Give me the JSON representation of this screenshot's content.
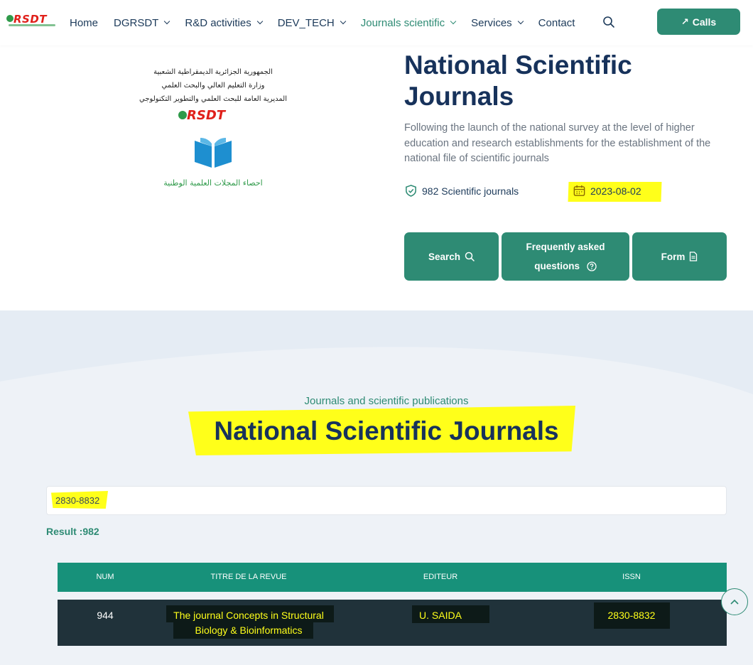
{
  "brand": {
    "logo_text": "RSDT"
  },
  "nav": {
    "items": [
      {
        "label": "Home",
        "has_dropdown": false,
        "active": false
      },
      {
        "label": "DGRSDT",
        "has_dropdown": true,
        "active": false
      },
      {
        "label": "R&D activities",
        "has_dropdown": true,
        "active": false
      },
      {
        "label": "DEV_TECH",
        "has_dropdown": true,
        "active": false
      },
      {
        "label": "Journals scientific",
        "has_dropdown": true,
        "active": true
      },
      {
        "label": "Services",
        "has_dropdown": true,
        "active": false
      },
      {
        "label": "Contact",
        "has_dropdown": false,
        "active": false
      }
    ],
    "search_icon": "search-icon",
    "calls_label": "Calls"
  },
  "hero": {
    "arabic_lines": [
      "الجمهورية الجزائرية الديمقراطية الشعبية",
      "وزارة التعليم العالي والبحث العلمي",
      "المديرية العامة للبحث العلمي والتطوير التكنولوجي"
    ],
    "arabic_caption": "احصاء المجلات العلمية الوطنية",
    "title": "National Scientific Journals",
    "description": "Following the launch of the national survey at the level of higher education and research establishments for the establishment of the national file of scientific journals",
    "journals_count": "982 Scientific journals",
    "date": "2023-08-02",
    "buttons": {
      "search": "Search",
      "faq_line1": "Frequently asked",
      "faq_line2": "questions",
      "form": "Form"
    }
  },
  "section": {
    "subtitle": "Journals and scientific publications",
    "title": "National Scientific Journals",
    "search_value": "2830-8832",
    "result": "Result :982"
  },
  "table": {
    "headers": [
      "NUM",
      "TITRE DE LA REVUE",
      "EDITEUR",
      "ISSN"
    ],
    "rows": [
      {
        "num": "944",
        "title_line1": "The journal Concepts in Structural",
        "title_line2": "Biology & Bioinformatics",
        "editor": "U. SAIDA",
        "issn": "2830-8832"
      }
    ]
  },
  "colors": {
    "accent": "#2e8b74",
    "title": "#17325b",
    "highlight": "#ffff1a",
    "row_bg": "#20323a"
  }
}
